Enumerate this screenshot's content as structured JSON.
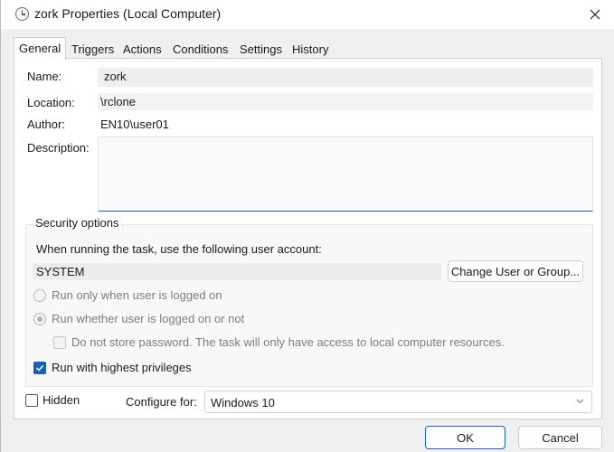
{
  "window": {
    "title": "zork Properties (Local Computer)"
  },
  "tabs": [
    {
      "label": "General",
      "active": true
    },
    {
      "label": "Triggers"
    },
    {
      "label": "Actions"
    },
    {
      "label": "Conditions"
    },
    {
      "label": "Settings"
    },
    {
      "label": "History"
    }
  ],
  "general": {
    "name_label": "Name:",
    "name_value": "zork",
    "location_label": "Location:",
    "location_value": "\\rclone",
    "author_label": "Author:",
    "author_value": "EN10\\user01",
    "description_label": "Description:",
    "description_value": ""
  },
  "security": {
    "group_title": "Security options",
    "account_prompt": "When running the task, use the following user account:",
    "account_value": "SYSTEM",
    "change_button": "Change User or Group...",
    "radio_logged_on": "Run only when user is logged on",
    "radio_whether": "Run whether user is logged on or not",
    "no_store_password": "Do not store password.  The task will only have access to local computer resources.",
    "highest_privileges": "Run with highest privileges"
  },
  "footer": {
    "hidden_label": "Hidden",
    "configure_label": "Configure for:",
    "configure_value": "Windows 10",
    "ok_button": "OK",
    "cancel_button": "Cancel"
  },
  "colors": {
    "accent": "#1a5fb4"
  }
}
